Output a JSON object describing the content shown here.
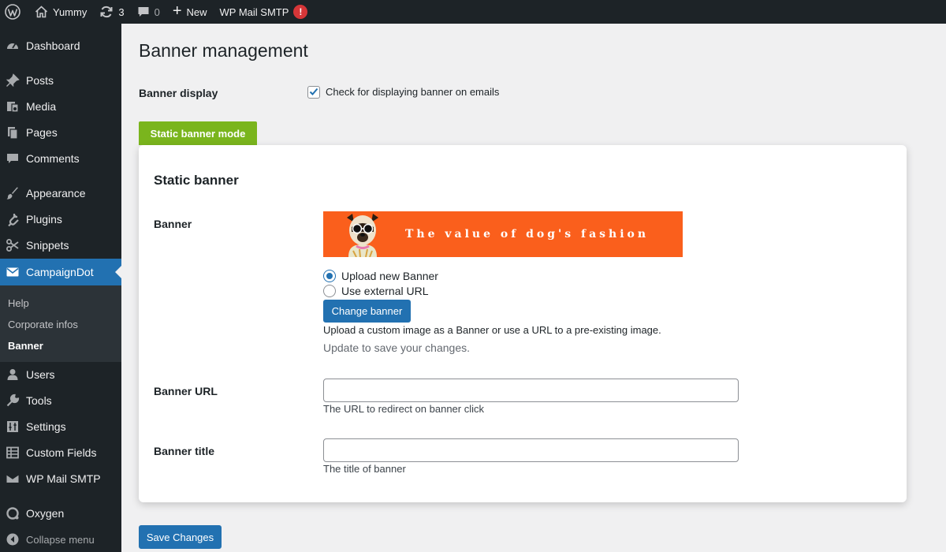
{
  "adminbar": {
    "site_name": "Yummy",
    "updates_count": "3",
    "comments_count": "0",
    "new_label": "New",
    "plugin_label": "WP Mail SMTP",
    "plugin_alert": "!"
  },
  "sidebar": {
    "items": [
      {
        "label": "Dashboard",
        "icon": "dashboard-icon"
      },
      {
        "label": "Posts",
        "icon": "pin-icon"
      },
      {
        "label": "Media",
        "icon": "media-icon"
      },
      {
        "label": "Pages",
        "icon": "pages-icon"
      },
      {
        "label": "Comments",
        "icon": "comment-icon"
      },
      {
        "label": "Appearance",
        "icon": "brush-icon"
      },
      {
        "label": "Plugins",
        "icon": "plug-icon"
      },
      {
        "label": "Snippets",
        "icon": "scissors-icon"
      },
      {
        "label": "CampaignDot",
        "icon": "envelope-icon"
      },
      {
        "label": "Users",
        "icon": "user-icon"
      },
      {
        "label": "Tools",
        "icon": "wrench-icon"
      },
      {
        "label": "Settings",
        "icon": "settings-icon"
      },
      {
        "label": "Custom Fields",
        "icon": "grid-icon"
      },
      {
        "label": "WP Mail SMTP",
        "icon": "mail-smtp-icon"
      },
      {
        "label": "Oxygen",
        "icon": "oxygen-icon"
      },
      {
        "label": "Collapse menu",
        "icon": "collapse-icon"
      }
    ],
    "submenu": [
      "Help",
      "Corporate infos",
      "Banner"
    ]
  },
  "page": {
    "title": "Banner management",
    "banner_display_label": "Banner display",
    "checkbox_label": "Check for displaying banner on emails",
    "checkbox_checked": true,
    "mode_tab": "Static banner mode",
    "save_label": "Save Changes"
  },
  "card": {
    "title": "Static banner",
    "banner_label": "Banner",
    "banner_image_text": "The value of dog's fashion",
    "radio_upload": "Upload new Banner",
    "radio_external": "Use external URL",
    "change_button": "Change banner",
    "help_text": "Upload a custom image as a Banner or use a URL to a pre-existing image.",
    "update_text": "Update to save your changes.",
    "url_label": "Banner URL",
    "url_value": "",
    "url_desc": "The URL to redirect on banner click",
    "title_label": "Banner title",
    "title_value": "",
    "title_desc": "The title of banner"
  },
  "colors": {
    "admin_dark": "#1d2327",
    "accent_blue": "#2271b1",
    "tab_green": "#7ab51d",
    "banner_orange": "#fa5f1c",
    "alert_red": "#d63638"
  }
}
